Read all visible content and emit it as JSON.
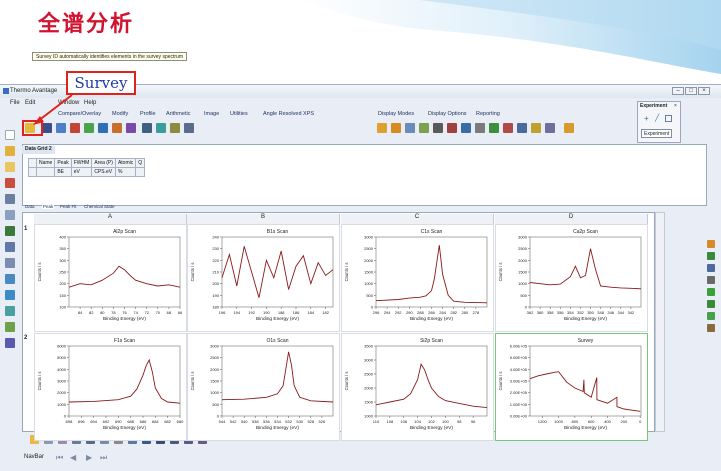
{
  "slide": {
    "title": "全谱分析"
  },
  "callout": {
    "label": "Survey"
  },
  "app": {
    "title": "Thermo Avantage",
    "menu": [
      "File",
      "Edit",
      "Window",
      "Help"
    ],
    "toolbar_top": [
      "Compare/Overlay",
      "Modify",
      "Profile",
      "Arithmetic",
      "Image",
      "Utilities",
      "Angle Resolved XPS",
      "Display Modes",
      "Display Options",
      "Reporting"
    ],
    "tooltip": "Survey ID automatically identifies elements in the survey spectrum",
    "experiment_panel": {
      "title": "Experiment",
      "button": "Experiment"
    },
    "data_grid": {
      "tab": "Data Grid 2",
      "columns": [
        {
          "top": "Name",
          "bottom": ""
        },
        {
          "top": "Peak",
          "bottom": "BE"
        },
        {
          "top": "FWHM",
          "bottom": "eV"
        },
        {
          "top": "Area (P)",
          "bottom": "CPS.eV"
        },
        {
          "top": "Atomic",
          "bottom": "%"
        },
        {
          "top": "Q",
          "bottom": ""
        }
      ]
    },
    "data_tabs": [
      "Data",
      "Peak",
      "Peak Fit",
      "Chemical State"
    ],
    "columns": [
      "A",
      "B",
      "C",
      "D"
    ],
    "rows": [
      "1",
      "2"
    ],
    "navbar_label": "NavBar",
    "colors": {
      "spectrum": "#8b1a1a",
      "selected_border": "#79c579",
      "callout_red": "#e0221c",
      "title_red": "#d2122e"
    }
  },
  "chart_data": [
    {
      "type": "line",
      "title": "Al2p Scan",
      "xlabel": "Binding Energy (eV)",
      "ylabel": "Counts / s",
      "xlim": [
        86,
        66
      ],
      "ylim": [
        100,
        400
      ],
      "xticks": [
        84,
        82,
        80,
        78,
        76,
        74,
        72,
        70,
        68,
        66
      ],
      "yticks": [
        100,
        150,
        200,
        250,
        300,
        350,
        400
      ],
      "x": [
        86,
        84,
        82,
        80,
        78,
        77,
        76,
        75,
        74,
        72,
        70,
        68,
        66
      ],
      "y": [
        185,
        200,
        195,
        215,
        245,
        275,
        260,
        235,
        215,
        200,
        190,
        195,
        185
      ]
    },
    {
      "type": "line",
      "title": "B1s Scan",
      "xlabel": "Binding Energy (eV)",
      "ylabel": "Counts / s",
      "xlim": [
        196,
        181
      ],
      "ylim": [
        180,
        240
      ],
      "xticks": [
        196,
        194,
        192,
        190,
        188,
        186,
        184,
        182
      ],
      "yticks": [
        180,
        190,
        200,
        210,
        220,
        230,
        240
      ],
      "x": [
        196,
        195,
        194,
        193,
        192,
        191,
        190,
        189,
        188,
        187,
        186,
        185,
        184,
        183,
        182,
        181
      ],
      "y": [
        205,
        225,
        198,
        232,
        210,
        188,
        220,
        205,
        228,
        195,
        215,
        224,
        200,
        218,
        207,
        212
      ]
    },
    {
      "type": "line",
      "title": "C1s Scan",
      "xlabel": "Binding Energy (eV)",
      "ylabel": "Counts / s",
      "xlim": [
        296,
        276
      ],
      "ylim": [
        0,
        3000
      ],
      "xticks": [
        296,
        294,
        292,
        290,
        288,
        286,
        284,
        282,
        280,
        278
      ],
      "yticks": [
        0,
        500,
        1000,
        1500,
        2000,
        2500,
        3000
      ],
      "x": [
        296,
        292,
        290,
        288,
        287,
        286,
        285.5,
        285,
        284.6,
        284,
        283,
        282,
        280,
        276
      ],
      "y": [
        270,
        320,
        380,
        420,
        480,
        700,
        1200,
        2000,
        2650,
        1400,
        500,
        250,
        200,
        180
      ]
    },
    {
      "type": "line",
      "title": "Ca2p Scan",
      "xlabel": "Binding Energy (eV)",
      "ylabel": "Counts / s",
      "xlim": [
        362,
        340
      ],
      "ylim": [
        0,
        3000
      ],
      "xticks": [
        362,
        360,
        358,
        356,
        354,
        352,
        350,
        348,
        346,
        344,
        342
      ],
      "yticks": [
        0,
        500,
        1000,
        1500,
        2000,
        2500,
        3000
      ],
      "x": [
        362,
        360,
        358,
        356,
        354,
        353,
        352,
        351,
        350,
        349,
        348,
        346,
        344,
        342,
        340
      ],
      "y": [
        1050,
        1000,
        950,
        980,
        1300,
        1750,
        1250,
        1350,
        2500,
        1600,
        900,
        850,
        820,
        800,
        780
      ]
    },
    {
      "type": "line",
      "title": "F1s Scan",
      "xlabel": "Binding Energy (eV)",
      "ylabel": "Counts / s",
      "xlim": [
        698,
        680
      ],
      "ylim": [
        0,
        6000
      ],
      "xticks": [
        698,
        696,
        694,
        692,
        690,
        688,
        686,
        684,
        682,
        680
      ],
      "yticks": [
        0,
        1000,
        2000,
        3000,
        4000,
        5000,
        6000
      ],
      "x": [
        698,
        694,
        690,
        688,
        687,
        686,
        685.5,
        685,
        684.5,
        684,
        683,
        682,
        680
      ],
      "y": [
        1200,
        1250,
        1400,
        1700,
        2300,
        3500,
        4300,
        4800,
        3800,
        2400,
        1500,
        1200,
        1100
      ]
    },
    {
      "type": "line",
      "title": "O1s Scan",
      "xlabel": "Binding Energy (eV)",
      "ylabel": "Counts / s",
      "xlim": [
        544,
        524
      ],
      "ylim": [
        0,
        3000
      ],
      "xticks": [
        544,
        542,
        540,
        538,
        536,
        534,
        532,
        530,
        528,
        526
      ],
      "yticks": [
        0,
        500,
        1000,
        1500,
        2000,
        2500,
        3000
      ],
      "x": [
        544,
        540,
        536,
        534,
        533,
        532.5,
        532,
        531.5,
        531,
        530,
        528,
        524
      ],
      "y": [
        700,
        720,
        800,
        950,
        1300,
        2000,
        2750,
        2200,
        1300,
        800,
        650,
        600
      ]
    },
    {
      "type": "line",
      "title": "Si2p Scan",
      "xlabel": "Binding Energy (eV)",
      "ylabel": "Counts / s",
      "xlim": [
        110,
        94
      ],
      "ylim": [
        1000,
        3500
      ],
      "xticks": [
        110,
        108,
        106,
        104,
        102,
        100,
        98,
        96
      ],
      "yticks": [
        1000,
        1500,
        2000,
        2500,
        3000,
        3500
      ],
      "x": [
        110,
        108,
        106,
        105,
        104,
        103.5,
        103,
        102.5,
        102,
        101,
        100,
        98,
        96,
        94
      ],
      "y": [
        1400,
        1500,
        1600,
        1800,
        2300,
        2850,
        2650,
        2300,
        2000,
        1700,
        1550,
        1450,
        1350,
        1300
      ]
    },
    {
      "type": "line",
      "title": "Survey",
      "xlabel": "Binding Energy (eV)",
      "ylabel": "Counts / s",
      "xlim": [
        1350,
        -10
      ],
      "ylim": [
        0,
        600000
      ],
      "xticks": [
        1200,
        1000,
        800,
        600,
        400,
        200,
        0
      ],
      "yticks": [
        0,
        100000,
        200000,
        300000,
        400000,
        500000,
        600000
      ],
      "ytick_labels": [
        "0.00E+00",
        "1.00E+05",
        "2.00E+05",
        "3.00E+05",
        "4.00E+05",
        "5.00E+05",
        "6.00E+05"
      ],
      "x": [
        1350,
        1250,
        1150,
        1050,
        1000,
        900,
        800,
        700,
        690,
        685,
        600,
        532,
        530,
        400,
        285,
        284,
        200,
        100,
        0
      ],
      "y": [
        320000,
        345000,
        360000,
        375000,
        380000,
        290000,
        240000,
        210000,
        310000,
        200000,
        160000,
        330000,
        140000,
        110000,
        160000,
        80000,
        60000,
        50000,
        40000
      ]
    }
  ]
}
